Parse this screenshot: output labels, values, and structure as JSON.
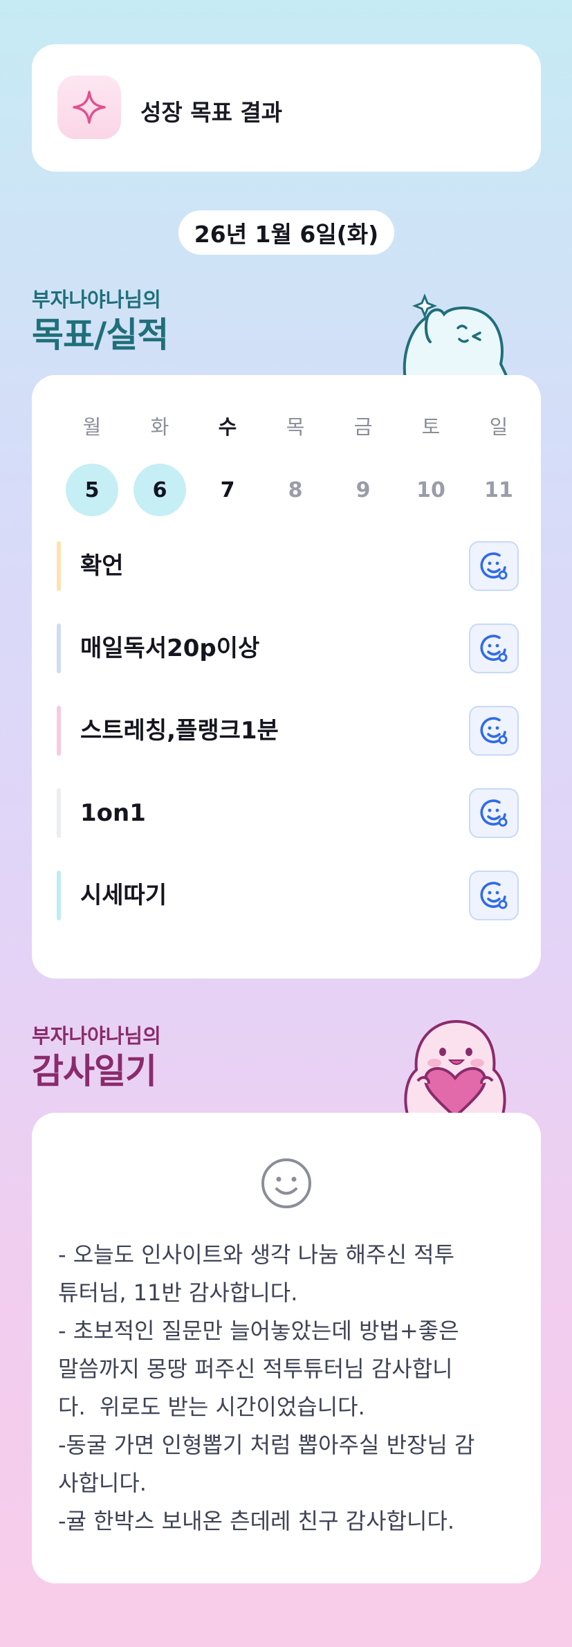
{
  "header": {
    "title": "성장 목표 결과",
    "icon": "sparkle-icon"
  },
  "date_label": "26년 1월 6일(화)",
  "goals_section": {
    "subtitle": "부자나야나님의",
    "title": "목표/실적"
  },
  "week": {
    "days": [
      {
        "name": "월",
        "num": "5",
        "state": "done"
      },
      {
        "name": "화",
        "num": "6",
        "state": "done"
      },
      {
        "name": "수",
        "num": "7",
        "state": "today"
      },
      {
        "name": "목",
        "num": "8",
        "state": "future"
      },
      {
        "name": "금",
        "num": "9",
        "state": "future"
      },
      {
        "name": "토",
        "num": "10",
        "state": "future"
      },
      {
        "name": "일",
        "num": "11",
        "state": "future"
      }
    ]
  },
  "goals": [
    {
      "label": "확언",
      "color": "#fbe2b0"
    },
    {
      "label": "매일독서20p이상",
      "color": "#cfdcf6"
    },
    {
      "label": "스트레칭,플랭크1분",
      "color": "#f8c9e2"
    },
    {
      "label": "1on1",
      "color": "#ecedf2"
    },
    {
      "label": "시세따기",
      "color": "#bfecf2"
    }
  ],
  "gratitude_section": {
    "subtitle": "부자나야나님의",
    "title": "감사일기"
  },
  "diary": {
    "icon": "smile-face-icon",
    "text": "- 오늘도 인사이트와 생각 나눔 해주신 적투\n튜터님, 11반 감사합니다.\n- 초보적인 질문만 늘어놓았는데 방법+좋은\n말씀까지 몽땅 퍼주신 적투튜터님 감사합니\n다.  위로도 받는 시간이었습니다.\n-동굴 가면 인형뽑기 처럼 뽑아주실 반장님 감\n사합니다.\n-귤 한박스 보내온 츤데레 친구 감사합니다."
  },
  "colors": {
    "accent_teal": "#1f6f7a",
    "accent_plum": "#8a2b6b",
    "goal_icon_blue": "#2f6ae8"
  }
}
